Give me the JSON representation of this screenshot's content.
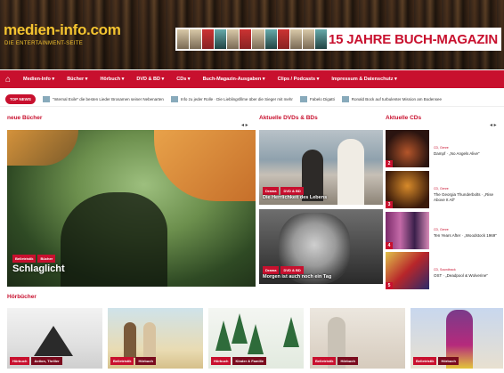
{
  "site": {
    "logo": "medien-info.com",
    "tagline": "DIE ENTERTAINMENT-SEITE"
  },
  "banner": {
    "title": "15 JAHRE BUCH-MAGAZIN"
  },
  "nav": {
    "home_icon": "home-icon",
    "items": [
      "Medien-Info",
      "Bücher",
      "Hörbuch",
      "DVD & BD",
      "CDs",
      "Buch-Magazin-Ausgaben",
      "Clips / Podcasts",
      "Impressum & Datenschutz"
    ]
  },
  "ticker": {
    "badge": "TOP NEWS",
    "items": [
      "\"Internal Exile\" die besten Lieder Brosamen seiner Nebenarten",
      "Info zu jeder Rolle · Die Lieblingsfilme über die Sieger mit mehr",
      "Fabelo Digatti",
      "Ronald Bock auf turbulenter Mission am Bodensee"
    ]
  },
  "sections": {
    "new_books": "neue Bücher",
    "dvds": "Aktuelle DVDs & BDs",
    "cds": "Aktuelle CDs",
    "audiobooks": "Hörbücher"
  },
  "feature": {
    "tags": [
      "Belletristik",
      "Bücher"
    ],
    "title": "Schlaglicht"
  },
  "dvds": [
    {
      "tags": [
        "Drama",
        "DVD & BD"
      ],
      "title": "Die Herrlichkeit des Lebens"
    },
    {
      "tags": [
        "Drama",
        "DVD & BD"
      ],
      "title": "Morgen ist auch noch ein Tag"
    }
  ],
  "cds": [
    {
      "rank": "2",
      "category": "CD, Genre",
      "title": "Dampf · „No Angels Alive“"
    },
    {
      "rank": "3",
      "category": "CD, Genre",
      "title": "The Georgia Thunderbolts · „Rise Above It All“"
    },
    {
      "rank": "4",
      "category": "CD, Genre",
      "title": "Ten Years After · „Woodstock 1969“"
    },
    {
      "rank": "5",
      "category": "CD, Soundtrack",
      "title": "OST · „Deadpool & Wolverine“"
    }
  ],
  "audiobooks": [
    {
      "tags": [
        "Hörbuch",
        "Action, Thriller"
      ]
    },
    {
      "tags": [
        "Belletristik",
        "Hörbuch"
      ]
    },
    {
      "tags": [
        "Hörbuch",
        "Kinder & Familie"
      ]
    },
    {
      "tags": [
        "Belletristik",
        "Hörbuch"
      ]
    },
    {
      "tags": [
        "Belletristik",
        "Hörbuch"
      ]
    }
  ],
  "colors": {
    "accent": "#c8102e",
    "logo": "#f4c430"
  }
}
